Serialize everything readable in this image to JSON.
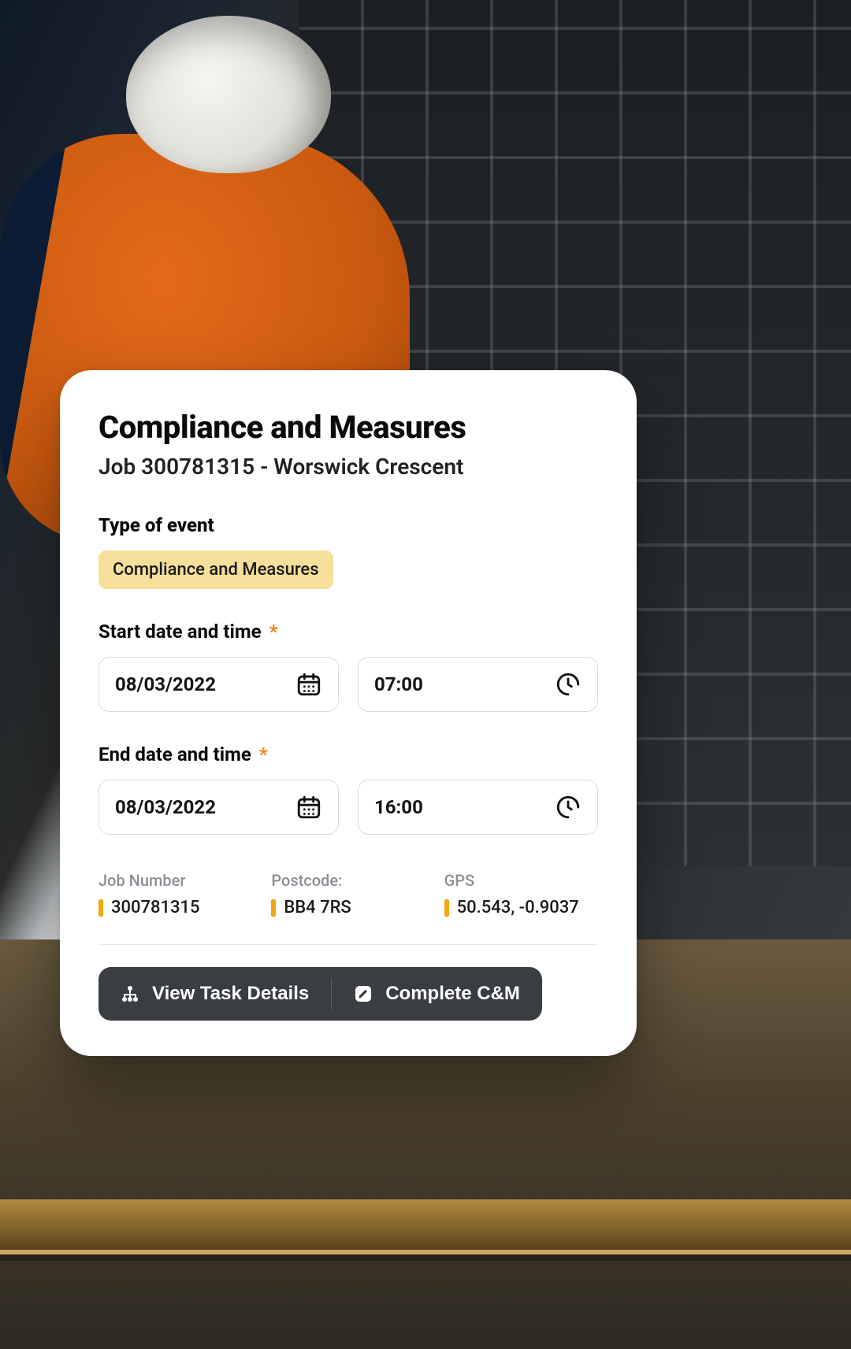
{
  "header": {
    "title": "Compliance and Measures",
    "subtitle": "Job 300781315 - Worswick Crescent"
  },
  "event": {
    "section_label": "Type of event",
    "chip": "Compliance and Measures"
  },
  "start": {
    "label": "Start date and time",
    "required_mark": "*",
    "date": "08/03/2022",
    "time": "07:00"
  },
  "end": {
    "label": "End date and time",
    "required_mark": "*",
    "date": "08/03/2022",
    "time": "16:00"
  },
  "meta": {
    "job_number": {
      "label": "Job Number",
      "value": "300781315"
    },
    "postcode": {
      "label": "Postcode:",
      "value": "BB4 7RS"
    },
    "gps": {
      "label": "GPS",
      "value": "50.543, -0.9037"
    }
  },
  "actions": {
    "view_task_details": "View Task Details",
    "complete_cm": "Complete C&M"
  },
  "colors": {
    "accent": "#f2a70f",
    "chip_bg": "#f6df9b",
    "button_bg": "#3a3e42"
  }
}
